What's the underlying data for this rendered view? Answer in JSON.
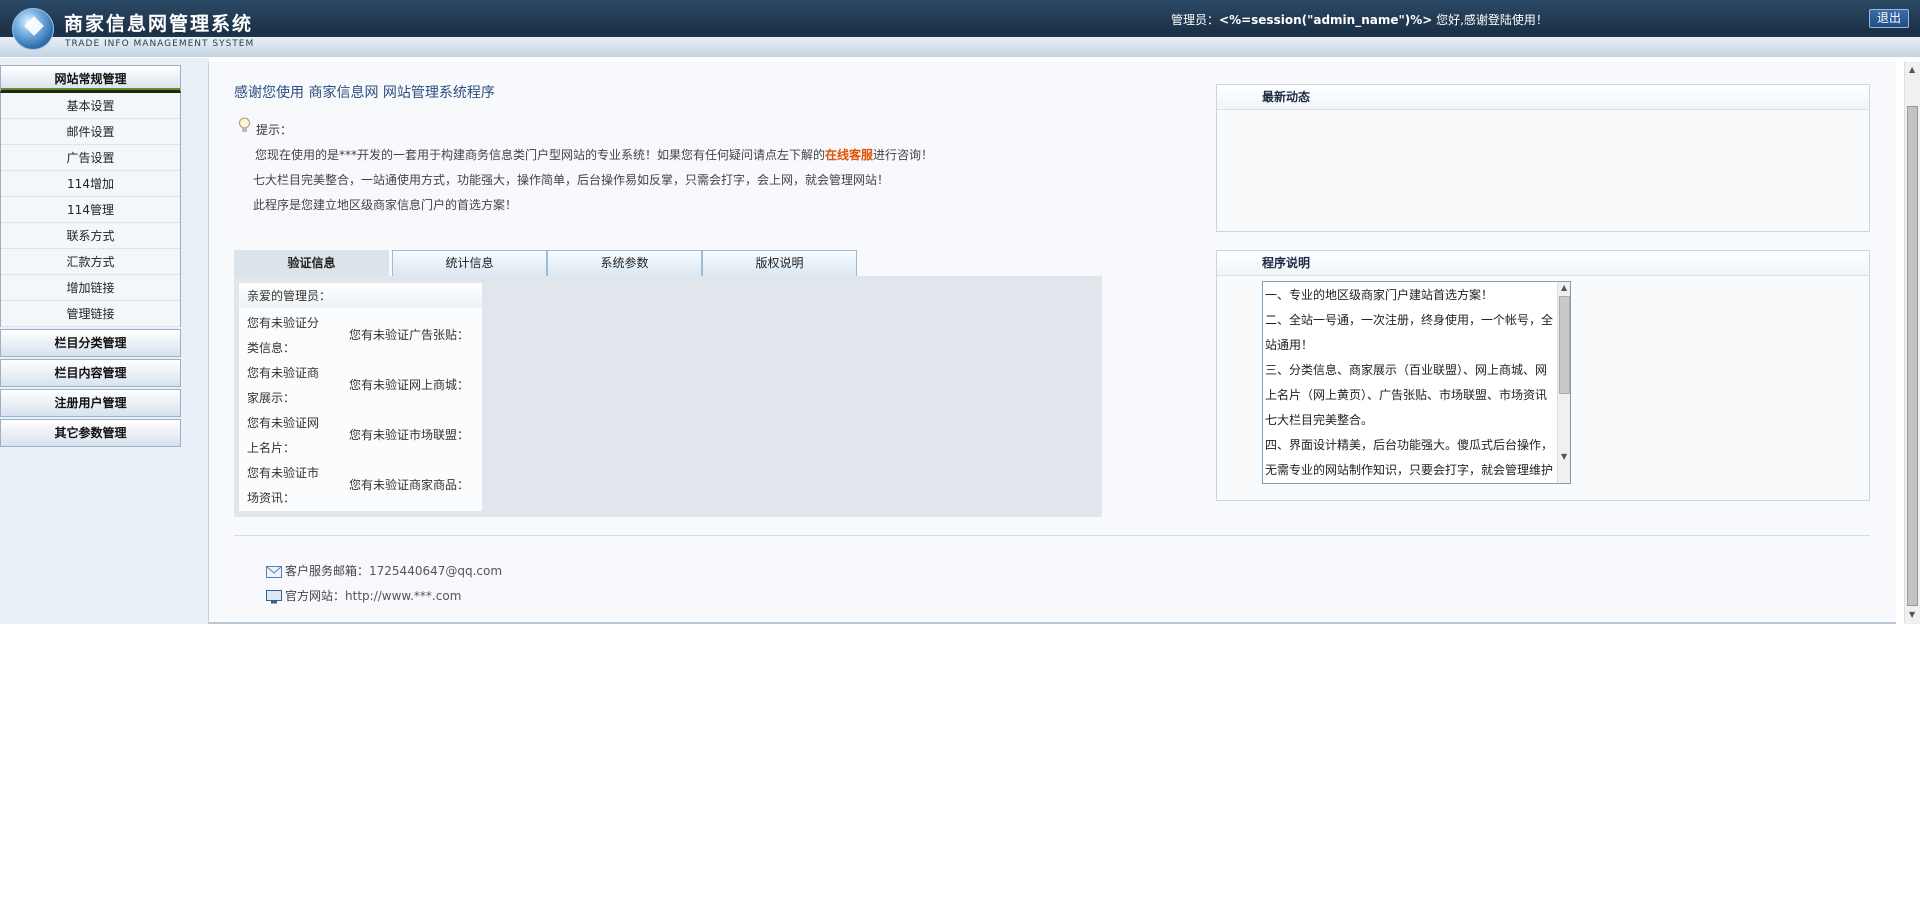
{
  "header": {
    "title": "商家信息网管理系统",
    "subtitle": "TRADE INFO MANAGEMENT SYSTEM",
    "admin_label": "管理员：",
    "admin_name": "<%=session(\"admin_name\")%>",
    "admin_suffix": " 您好,感谢登陆使用！",
    "logout_label": "退出"
  },
  "sidebar": {
    "active_group": "网站常规管理",
    "items": [
      "基本设置",
      "邮件设置",
      "广告设置",
      "114增加",
      "114管理",
      "联系方式",
      "汇款方式",
      "增加链接",
      "管理链接"
    ],
    "groups": [
      "栏目分类管理",
      "栏目内容管理",
      "注册用户管理",
      "其它参数管理"
    ]
  },
  "main": {
    "title": "感谢您使用 商家信息网 网站管理系统程序",
    "hint_label": "提示：",
    "hint_line1_pre": "您现在使用的是***开发的一套用于构建商务信息类门户型网站的专业系统！如果您有任何疑问请点左下解的",
    "hint_line1_link": "在线客服",
    "hint_line1_post": "进行咨询！",
    "hint_line2": "七大栏目完美整合，一站通使用方式，功能强大，操作简单，后台操作易如反掌，只需会打字，会上网，就会管理网站！",
    "hint_line3": "此程序是您建立地区级商家信息门户的首选方案！",
    "tabs": [
      "验证信息",
      "统计信息",
      "系统参数",
      "版权说明"
    ],
    "verify_head": "亲爱的管理员：",
    "verify": {
      "c1": "您有未验证分类信息：",
      "c2": "您有未验证广告张贴：",
      "c3": "您有未验证商家展示：",
      "c4": "您有未验证网上商城：",
      "c5": "您有未验证网上名片：",
      "c6": "您有未验证市场联盟：",
      "c7": "您有未验证市场资讯：",
      "c8": "您有未验证商家商品："
    }
  },
  "news": {
    "title": "最新动态"
  },
  "notes": {
    "title": "程序说明",
    "text": "一、专业的地区级商家门户建站首选方案！\n二、全站一号通，一次注册，终身使用，一个帐号，全站通用！\n三、分类信息、商家展示（百业联盟）、网上商城、网上名片（网上黄页）、广告张贴、市场联盟、市场资讯七大栏目完美整合。\n四、界面设计精美，后台功能强大。傻瓜式后台操作，无需专业的网站制作知识，只要会打字，就会管理维护"
  },
  "footer": {
    "email_label": "客户服务邮箱：",
    "email": "1725440647@qq.com",
    "site_label": "官方网站：",
    "site": "http://www.***.com"
  }
}
